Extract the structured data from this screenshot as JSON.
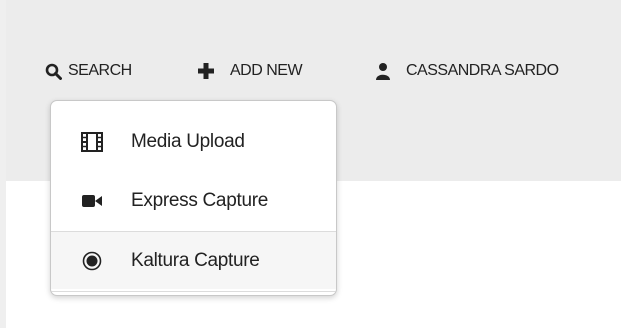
{
  "nav": {
    "search_label": "SEARCH",
    "add_new_label": "ADD NEW",
    "user_label": "CASSANDRA SARDO"
  },
  "dropdown": {
    "items": [
      {
        "label": "Media Upload",
        "icon": "film-icon"
      },
      {
        "label": "Express Capture",
        "icon": "video-camera-icon"
      },
      {
        "label": "Kaltura Capture",
        "icon": "record-icon"
      }
    ]
  },
  "colors": {
    "header_bg": "#ececec",
    "text": "#222222",
    "hover_bg": "#f6f6f6"
  }
}
